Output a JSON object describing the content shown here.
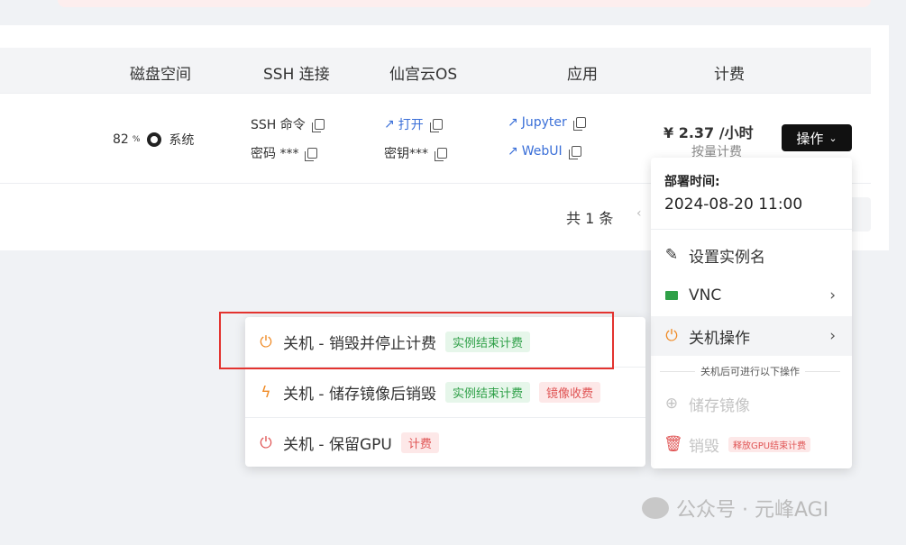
{
  "table": {
    "headers": [
      "磁盘空间",
      "SSH 连接",
      "仙宫云OS",
      "应用",
      "计费"
    ],
    "disk": {
      "percent": "82",
      "percent_unit": "%",
      "label": "系统"
    },
    "ssh": {
      "command": "SSH 命令",
      "password": "密码 ***"
    },
    "os": {
      "open": "打开",
      "key": "密钥***"
    },
    "apps": {
      "jupyter": "Jupyter",
      "webui": "WebUI"
    },
    "billing": {
      "price": "¥ 2.37 /小时",
      "mode": "按量计费"
    },
    "op_button": "操作"
  },
  "pagination": {
    "total": "共 1 条",
    "prev": "‹"
  },
  "menu": {
    "deploy_label": "部署时间:",
    "deploy_time": "2024-08-20 11:00",
    "items": [
      {
        "label": "设置实例名",
        "icon": "edit-icon"
      },
      {
        "label": "VNC",
        "icon": "monitor-icon"
      },
      {
        "label": "关机操作",
        "icon": "power-icon"
      }
    ],
    "divider_text": "关机后可进行以下操作",
    "disabled_items": [
      {
        "label": "储存镜像",
        "icon": "save-icon"
      },
      {
        "label": "销毁",
        "icon": "trash-icon",
        "tag": "释放GPU结束计费"
      }
    ]
  },
  "submenu": {
    "items": [
      {
        "label": "关机 - 销毁并停止计费",
        "tags": [
          "实例结束计费"
        ]
      },
      {
        "label": "关机 - 储存镜像后销毁",
        "tags": [
          "实例结束计费",
          "镜像收费"
        ]
      },
      {
        "label": "关机 - 保留GPU",
        "tags": [
          "计费"
        ]
      }
    ]
  },
  "watermark": "公众号 · 元峰AGI",
  "colors": {
    "highlight": "#e3332f",
    "green": "#2fa048",
    "red": "#e05555",
    "link": "#3a6fd8",
    "orange": "#f08a24"
  }
}
